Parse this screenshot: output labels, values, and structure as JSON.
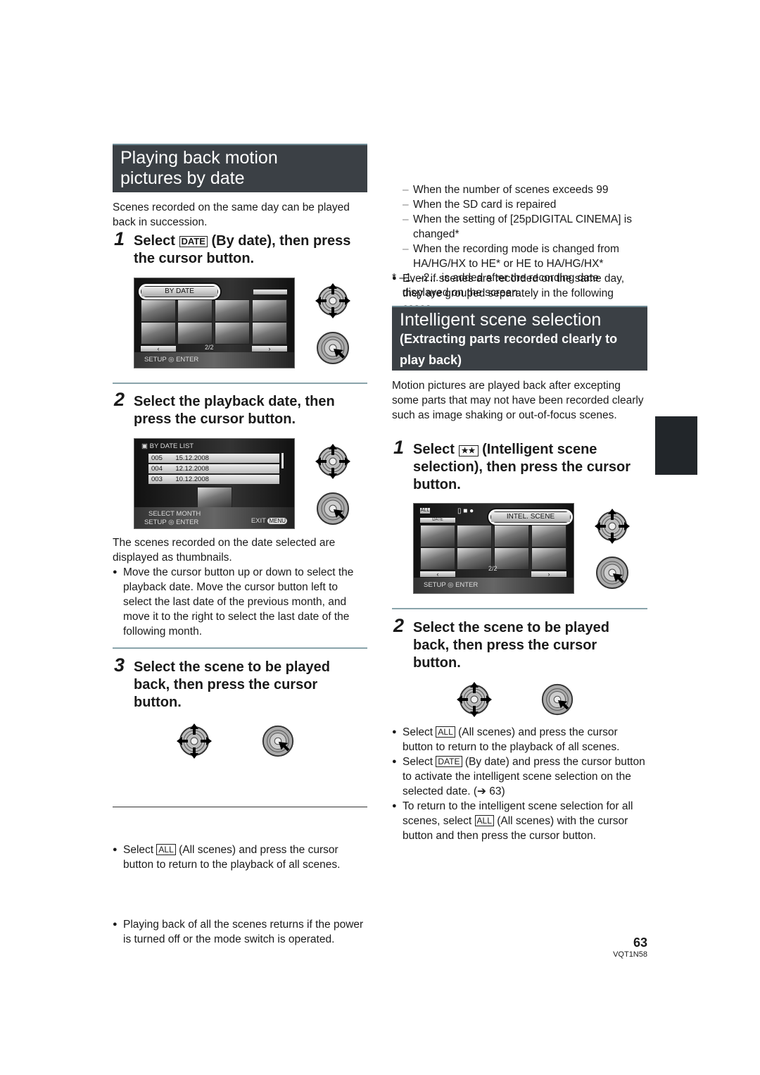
{
  "left": {
    "title": [
      "Playing back motion",
      "pictures by date"
    ],
    "intro": "Scenes recorded on the same day can be played back in succession.",
    "step1": {
      "num": "1",
      "pre": "Select",
      "icon": "DATE",
      "post": "(By date), then press the cursor button."
    },
    "screen1": {
      "button": "BY DATE",
      "page": "2/2",
      "footer": "SETUP ◎ ENTER"
    },
    "step2": {
      "num": "2",
      "text": "Select the playback date, then press the cursor button."
    },
    "screen2": {
      "title": "BY DATE LIST",
      "rows": [
        {
          "no": "005",
          "date": "15.12.2008"
        },
        {
          "no": "004",
          "date": "12.12.2008"
        },
        {
          "no": "003",
          "date": "10.12.2008"
        }
      ],
      "footer1": "SELECT MONTH",
      "footer2": "SETUP ◎ ENTER",
      "exit": "EXIT",
      "menu": "MENU"
    },
    "after2": "The scenes recorded on the date selected are displayed as thumbnails.",
    "bullet2": "Move the cursor button up or down to select the playback date. Move the cursor button left to select the last date of the previous month, and move it to the right to select the last date of the following month.",
    "step3": {
      "num": "3",
      "text": "Select the scene to be played back, then press the cursor button."
    },
    "bullet3": {
      "pre": "Select",
      "icon": "ALL",
      "post": "(All scenes) and press the cursor button to return to the playback of all scenes."
    },
    "bullet4": "Playing back of all the scenes returns if the power is turned off or the mode switch is operated."
  },
  "right": {
    "bullet1": "Even if scenes are recorded on the same day, they are grouped separately in the following cases.",
    "dashes": [
      "When the number of scenes exceeds 99",
      "When the SD card is repaired",
      "When the setting of [25pDIGITAL CINEMA] is changed*",
      "When the recording mode is changed from HA/HG/HX to HE* or HE to HA/HG/HX*"
    ],
    "note": "* –1, –2... is added after the recording date displayed on the screen.",
    "title": "Intelligent scene selection",
    "subtitle": "(Extracting parts recorded clearly to play back)",
    "intro": "Motion pictures are played back after excepting some parts that may not have been recorded clearly such as image shaking or out-of-focus scenes.",
    "step1": {
      "num": "1",
      "pre": "Select",
      "post": "(Intelligent scene selection), then press the cursor button."
    },
    "screen": {
      "all": "ALL",
      "date": "DATE",
      "button": "INTEL. SCENE",
      "page": "2/2",
      "footer": "SETUP ◎ ENTER"
    },
    "step2": {
      "num": "2",
      "text": "Select the scene to be played back, then press the cursor button."
    },
    "bullets": [
      {
        "pre": "Select",
        "icon": "ALL",
        "post": "(All scenes) and press the cursor button to return to the playback of all scenes."
      },
      {
        "pre": "Select",
        "icon": "DATE",
        "post": "(By date) and press the cursor button to activate the intelligent scene selection on the selected date. (➔ 63)"
      },
      {
        "pre": "To return to the intelligent scene selection for all scenes, select",
        "icon": "ALL",
        "post": "(All scenes) with the cursor button and then press the cursor button."
      }
    ]
  },
  "page_number": "63",
  "doc_code": "VQT1N58",
  "colors": {
    "heading_bg": "#3b4045",
    "rule": "#8aa4ab",
    "tab": "#22262a"
  }
}
